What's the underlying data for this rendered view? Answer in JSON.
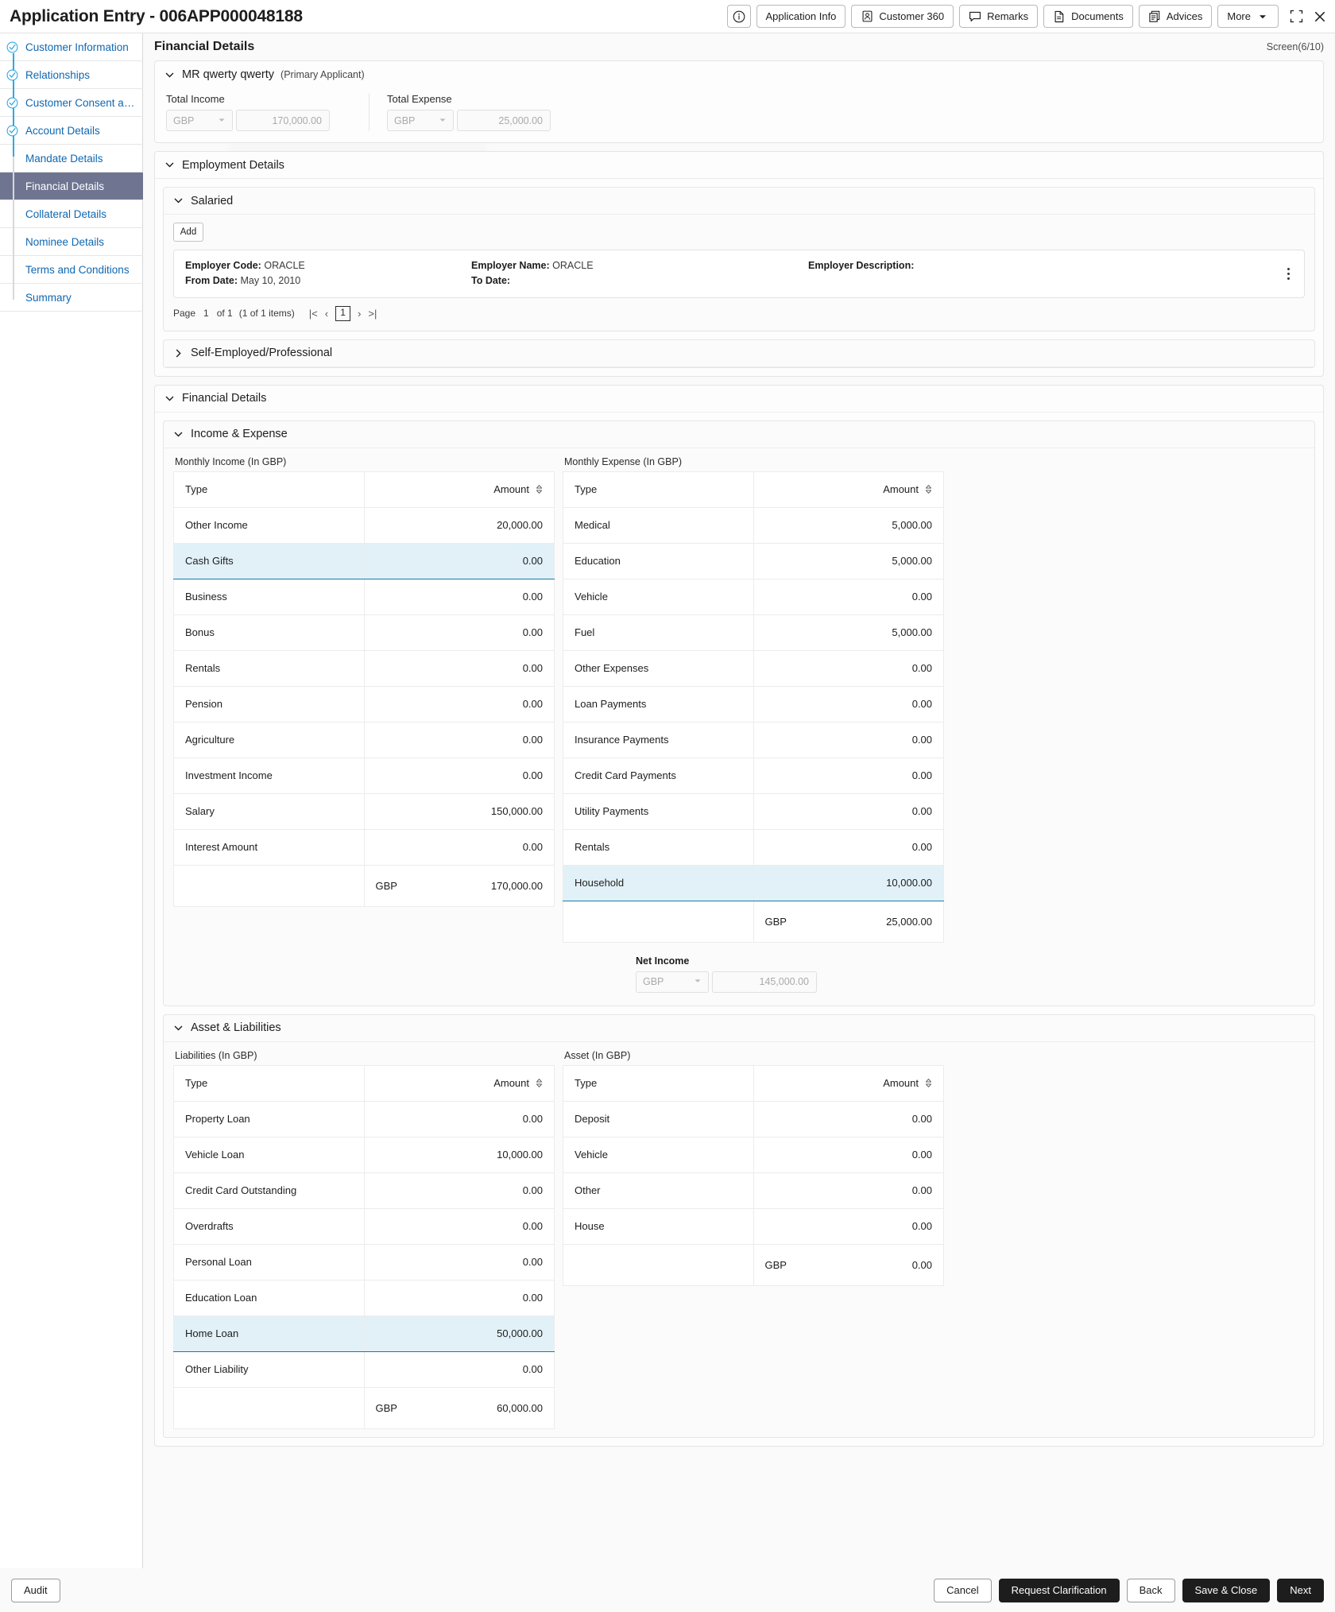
{
  "titlebar": {
    "title": "Application Entry - 006APP000048188",
    "actions": [
      {
        "label": "",
        "icon": "info-circle-icon",
        "name": "info-button"
      },
      {
        "label": "Application Info",
        "icon": "",
        "name": "application-info-button"
      },
      {
        "label": "Customer 360",
        "icon": "user-badge-icon",
        "name": "customer-360-button"
      },
      {
        "label": "Remarks",
        "icon": "comment-icon",
        "name": "remarks-button"
      },
      {
        "label": "Documents",
        "icon": "document-icon",
        "name": "documents-button"
      },
      {
        "label": "Advices",
        "icon": "copy-icon",
        "name": "advices-button"
      },
      {
        "label": "More",
        "icon": "chevron-down-icon",
        "name": "more-button"
      }
    ],
    "window_controls": [
      "minimize-restore-icon",
      "close-icon"
    ]
  },
  "sidebar": {
    "items": [
      {
        "label": "Customer Information",
        "state": "done"
      },
      {
        "label": "Relationships",
        "state": "done"
      },
      {
        "label": "Customer Consent and …",
        "state": "done"
      },
      {
        "label": "Account Details",
        "state": "done"
      },
      {
        "label": "Mandate Details",
        "state": "todo"
      },
      {
        "label": "Financial Details",
        "state": "active"
      },
      {
        "label": "Collateral Details",
        "state": "todo"
      },
      {
        "label": "Nominee Details",
        "state": "todo"
      },
      {
        "label": "Terms and Conditions",
        "state": "todo"
      },
      {
        "label": "Summary",
        "state": "todo"
      }
    ]
  },
  "page": {
    "title": "Financial Details",
    "screen_counter": "Screen(6/10)"
  },
  "applicant": {
    "name": "MR qwerty qwerty",
    "role": "(Primary Applicant)",
    "total_income": {
      "label": "Total Income",
      "currency": "GBP",
      "amount": "170,000.00"
    },
    "total_expense": {
      "label": "Total Expense",
      "currency": "GBP",
      "amount": "25,000.00"
    }
  },
  "employment": {
    "title": "Employment Details",
    "salaried": {
      "title": "Salaried",
      "add_label": "Add",
      "record": {
        "employer_code_label": "Employer Code:",
        "employer_code_value": "ORACLE",
        "from_date_label": "From Date:",
        "from_date_value": "May 10, 2010",
        "employer_name_label": "Employer Name:",
        "employer_name_value": "ORACLE",
        "to_date_label": "To Date:",
        "to_date_value": "",
        "employer_description_label": "Employer Description:",
        "employer_description_value": ""
      },
      "pager": {
        "page_label": "Page",
        "page_value": "1",
        "of_text": "of 1",
        "items_text": "(1 of 1 items)",
        "current_page": "1"
      }
    },
    "self_employed": {
      "title": "Self-Employed/Professional"
    }
  },
  "financial_details": {
    "title": "Financial Details",
    "income_expense": {
      "title": "Income & Expense",
      "income_caption": "Monthly Income (In GBP)",
      "expense_caption": "Monthly Expense (In GBP)",
      "col_type": "Type",
      "col_amount": "Amount",
      "net_income": {
        "label": "Net Income",
        "currency": "GBP",
        "amount": "145,000.00"
      }
    },
    "asset_liabilities": {
      "title": "Asset & Liabilities",
      "liabilities_caption": "Liabilities (In GBP)",
      "asset_caption": "Asset (In GBP)",
      "col_type": "Type",
      "col_amount": "Amount"
    }
  },
  "chart_data": {
    "type": "table",
    "tables": [
      {
        "name": "monthly_income",
        "title": "Monthly Income (In GBP)",
        "columns": [
          "Type",
          "Amount"
        ],
        "rows": [
          {
            "type": "Other Income",
            "amount": "20,000.00",
            "selected": false
          },
          {
            "type": "Cash Gifts",
            "amount": "0.00",
            "selected": true
          },
          {
            "type": "Business",
            "amount": "0.00",
            "selected": false
          },
          {
            "type": "Bonus",
            "amount": "0.00",
            "selected": false
          },
          {
            "type": "Rentals",
            "amount": "0.00",
            "selected": false
          },
          {
            "type": "Pension",
            "amount": "0.00",
            "selected": false
          },
          {
            "type": "Agriculture",
            "amount": "0.00",
            "selected": false
          },
          {
            "type": "Investment Income",
            "amount": "0.00",
            "selected": false
          },
          {
            "type": "Salary",
            "amount": "150,000.00",
            "selected": false
          },
          {
            "type": "Interest Amount",
            "amount": "0.00",
            "selected": false
          }
        ],
        "total": {
          "currency": "GBP",
          "amount": "170,000.00"
        }
      },
      {
        "name": "monthly_expense",
        "title": "Monthly Expense (In GBP)",
        "columns": [
          "Type",
          "Amount"
        ],
        "rows": [
          {
            "type": "Medical",
            "amount": "5,000.00",
            "selected": false
          },
          {
            "type": "Education",
            "amount": "5,000.00",
            "selected": false
          },
          {
            "type": "Vehicle",
            "amount": "0.00",
            "selected": false
          },
          {
            "type": "Fuel",
            "amount": "5,000.00",
            "selected": false
          },
          {
            "type": "Other Expenses",
            "amount": "0.00",
            "selected": false
          },
          {
            "type": "Loan Payments",
            "amount": "0.00",
            "selected": false
          },
          {
            "type": "Insurance Payments",
            "amount": "0.00",
            "selected": false
          },
          {
            "type": "Credit Card Payments",
            "amount": "0.00",
            "selected": false
          },
          {
            "type": "Utility Payments",
            "amount": "0.00",
            "selected": false
          },
          {
            "type": "Rentals",
            "amount": "0.00",
            "selected": false
          },
          {
            "type": "Household",
            "amount": "10,000.00",
            "selected": true
          }
        ],
        "total": {
          "currency": "GBP",
          "amount": "25,000.00"
        }
      },
      {
        "name": "liabilities",
        "title": "Liabilities (In GBP)",
        "columns": [
          "Type",
          "Amount"
        ],
        "rows": [
          {
            "type": "Property Loan",
            "amount": "0.00",
            "selected": false
          },
          {
            "type": "Vehicle Loan",
            "amount": "10,000.00",
            "selected": false
          },
          {
            "type": "Credit Card Outstanding",
            "amount": "0.00",
            "selected": false
          },
          {
            "type": "Overdrafts",
            "amount": "0.00",
            "selected": false
          },
          {
            "type": "Personal Loan",
            "amount": "0.00",
            "selected": false
          },
          {
            "type": "Education Loan",
            "amount": "0.00",
            "selected": false
          },
          {
            "type": "Home Loan",
            "amount": "50,000.00",
            "selected": true
          },
          {
            "type": "Other Liability",
            "amount": "0.00",
            "selected": false
          }
        ],
        "total": {
          "currency": "GBP",
          "amount": "60,000.00"
        }
      },
      {
        "name": "asset",
        "title": "Asset (In GBP)",
        "columns": [
          "Type",
          "Amount"
        ],
        "rows": [
          {
            "type": "Deposit",
            "amount": "0.00",
            "selected": false
          },
          {
            "type": "Vehicle",
            "amount": "0.00",
            "selected": false
          },
          {
            "type": "Other",
            "amount": "0.00",
            "selected": false
          },
          {
            "type": "House",
            "amount": "0.00",
            "selected": false
          }
        ],
        "total": {
          "currency": "GBP",
          "amount": "0.00"
        }
      }
    ]
  },
  "footer": {
    "audit": "Audit",
    "cancel": "Cancel",
    "request_clarification": "Request Clarification",
    "back": "Back",
    "save_close": "Save & Close",
    "next": "Next"
  },
  "colors": {
    "accent_blue": "#0f67b1",
    "selected_row": "#e2f1f8",
    "selected_border": "#1a7aa2",
    "active_nav": "#6f7591",
    "connector": "#2fa8e0",
    "dark_button": "#1d1d1d"
  }
}
